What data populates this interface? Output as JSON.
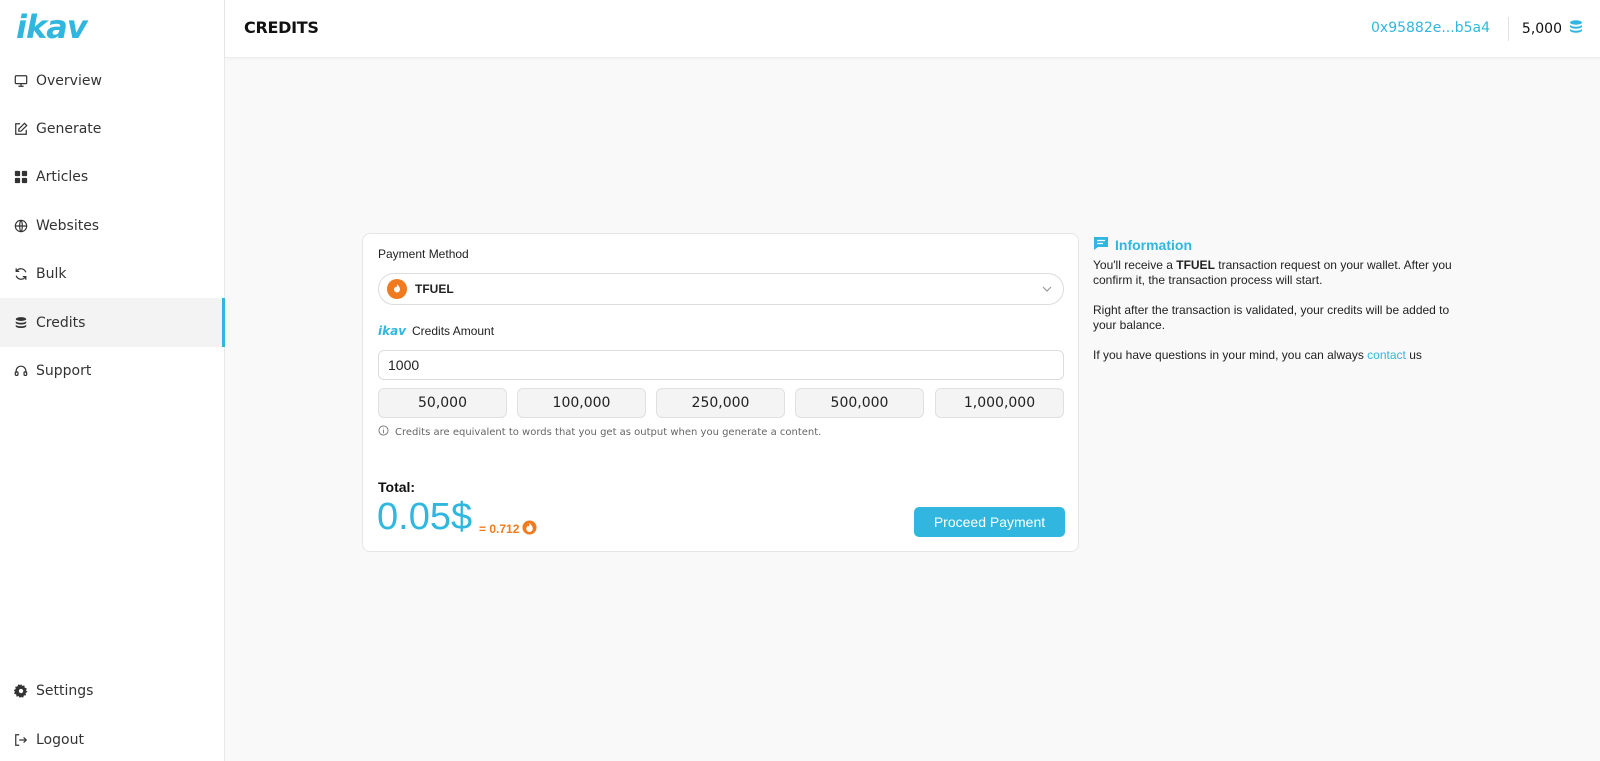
{
  "app": {
    "logo_text": "ikav",
    "brand_color": "#31b7df",
    "accent_orange": "#f07a1d"
  },
  "sidebar": {
    "items": [
      {
        "label": "Overview",
        "icon": "monitor-icon"
      },
      {
        "label": "Generate",
        "icon": "edit-icon"
      },
      {
        "label": "Articles",
        "icon": "grid-icon"
      },
      {
        "label": "Websites",
        "icon": "globe-icon"
      },
      {
        "label": "Bulk",
        "icon": "refresh-icon"
      },
      {
        "label": "Credits",
        "icon": "coins-icon",
        "active": true
      },
      {
        "label": "Support",
        "icon": "headset-icon"
      }
    ],
    "bottom_items": [
      {
        "label": "Settings",
        "icon": "gear-icon"
      },
      {
        "label": "Logout",
        "icon": "logout-icon"
      }
    ]
  },
  "header": {
    "title": "CREDITS",
    "wallet_address": "0x95882e...b5a4",
    "balance": "5,000"
  },
  "payment": {
    "method_label": "Payment Method",
    "method_value": "TFUEL",
    "credits_logo": "ikav",
    "credits_label": "Credits Amount",
    "credits_value": "1000",
    "presets": [
      "50,000",
      "100,000",
      "250,000",
      "500,000",
      "1,000,000"
    ],
    "hint": "Credits are equivalent to words that you get as output when you generate a content.",
    "total_label": "Total:",
    "total_value": "0.05$",
    "total_tfuel": "= 0.712",
    "proceed_label": "Proceed Payment"
  },
  "information": {
    "title": "Information",
    "p1_a": "You'll receive a ",
    "p1_bold": "TFUEL",
    "p1_b": " transaction request on your wallet. After you confirm it, the transaction process will start.",
    "p2": "Right after the transaction is validated, your credits will be added to your balance.",
    "p3_a": "If you have questions in your mind, you can always ",
    "p3_link": "contact",
    "p3_b": " us"
  }
}
